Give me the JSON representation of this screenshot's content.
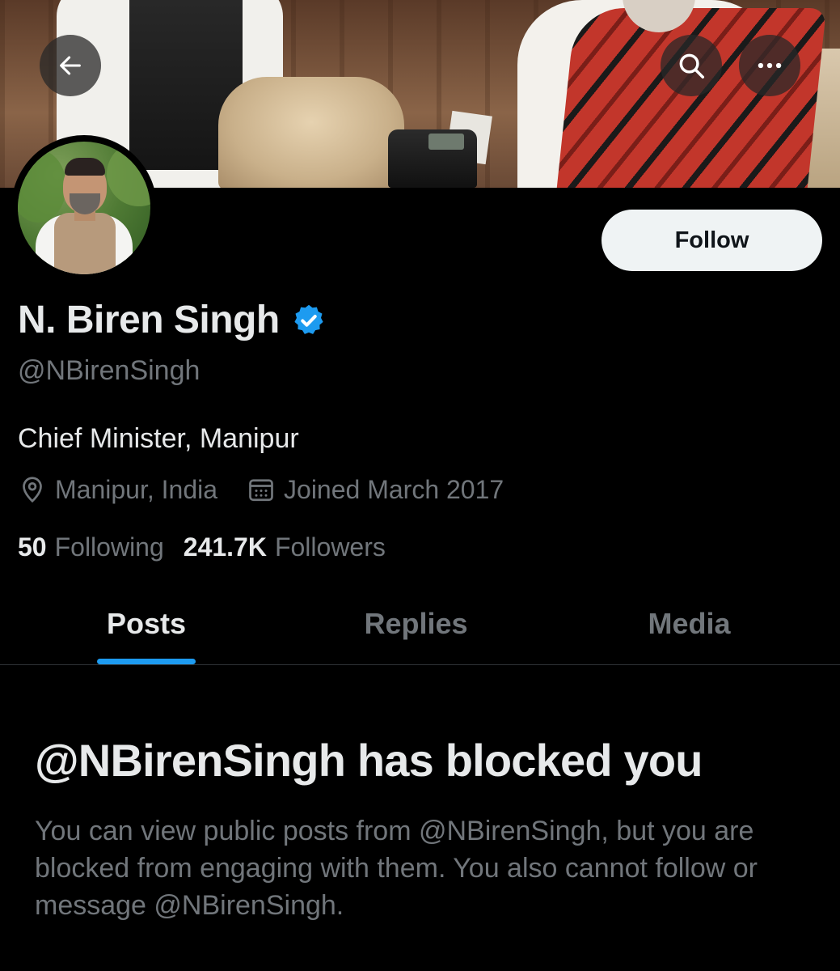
{
  "header": {
    "back_icon": "arrow-left-icon",
    "search_icon": "search-icon",
    "more_icon": "more-horizontal-icon"
  },
  "profile": {
    "display_name": "N. Biren Singh",
    "verified": true,
    "verified_color": "#1d9bf0",
    "handle": "@NBirenSingh",
    "bio": "Chief Minister, Manipur",
    "location": "Manipur, India",
    "joined": "Joined March 2017",
    "following_count": "50",
    "following_label": "Following",
    "followers_count": "241.7K",
    "followers_label": "Followers"
  },
  "actions": {
    "follow_label": "Follow"
  },
  "tabs": [
    {
      "label": "Posts",
      "active": true
    },
    {
      "label": "Replies",
      "active": false
    },
    {
      "label": "Media",
      "active": false
    }
  ],
  "blocked": {
    "title": "@NBirenSingh has blocked you",
    "description": "You can view public posts from @NBirenSingh, but you are blocked from engaging with them. You also cannot follow or message @NBirenSingh."
  },
  "colors": {
    "background": "#000000",
    "primary_text": "#e7e9ea",
    "secondary_text": "#71767b",
    "accent": "#1d9bf0",
    "follow_button_bg": "#eff3f4"
  }
}
